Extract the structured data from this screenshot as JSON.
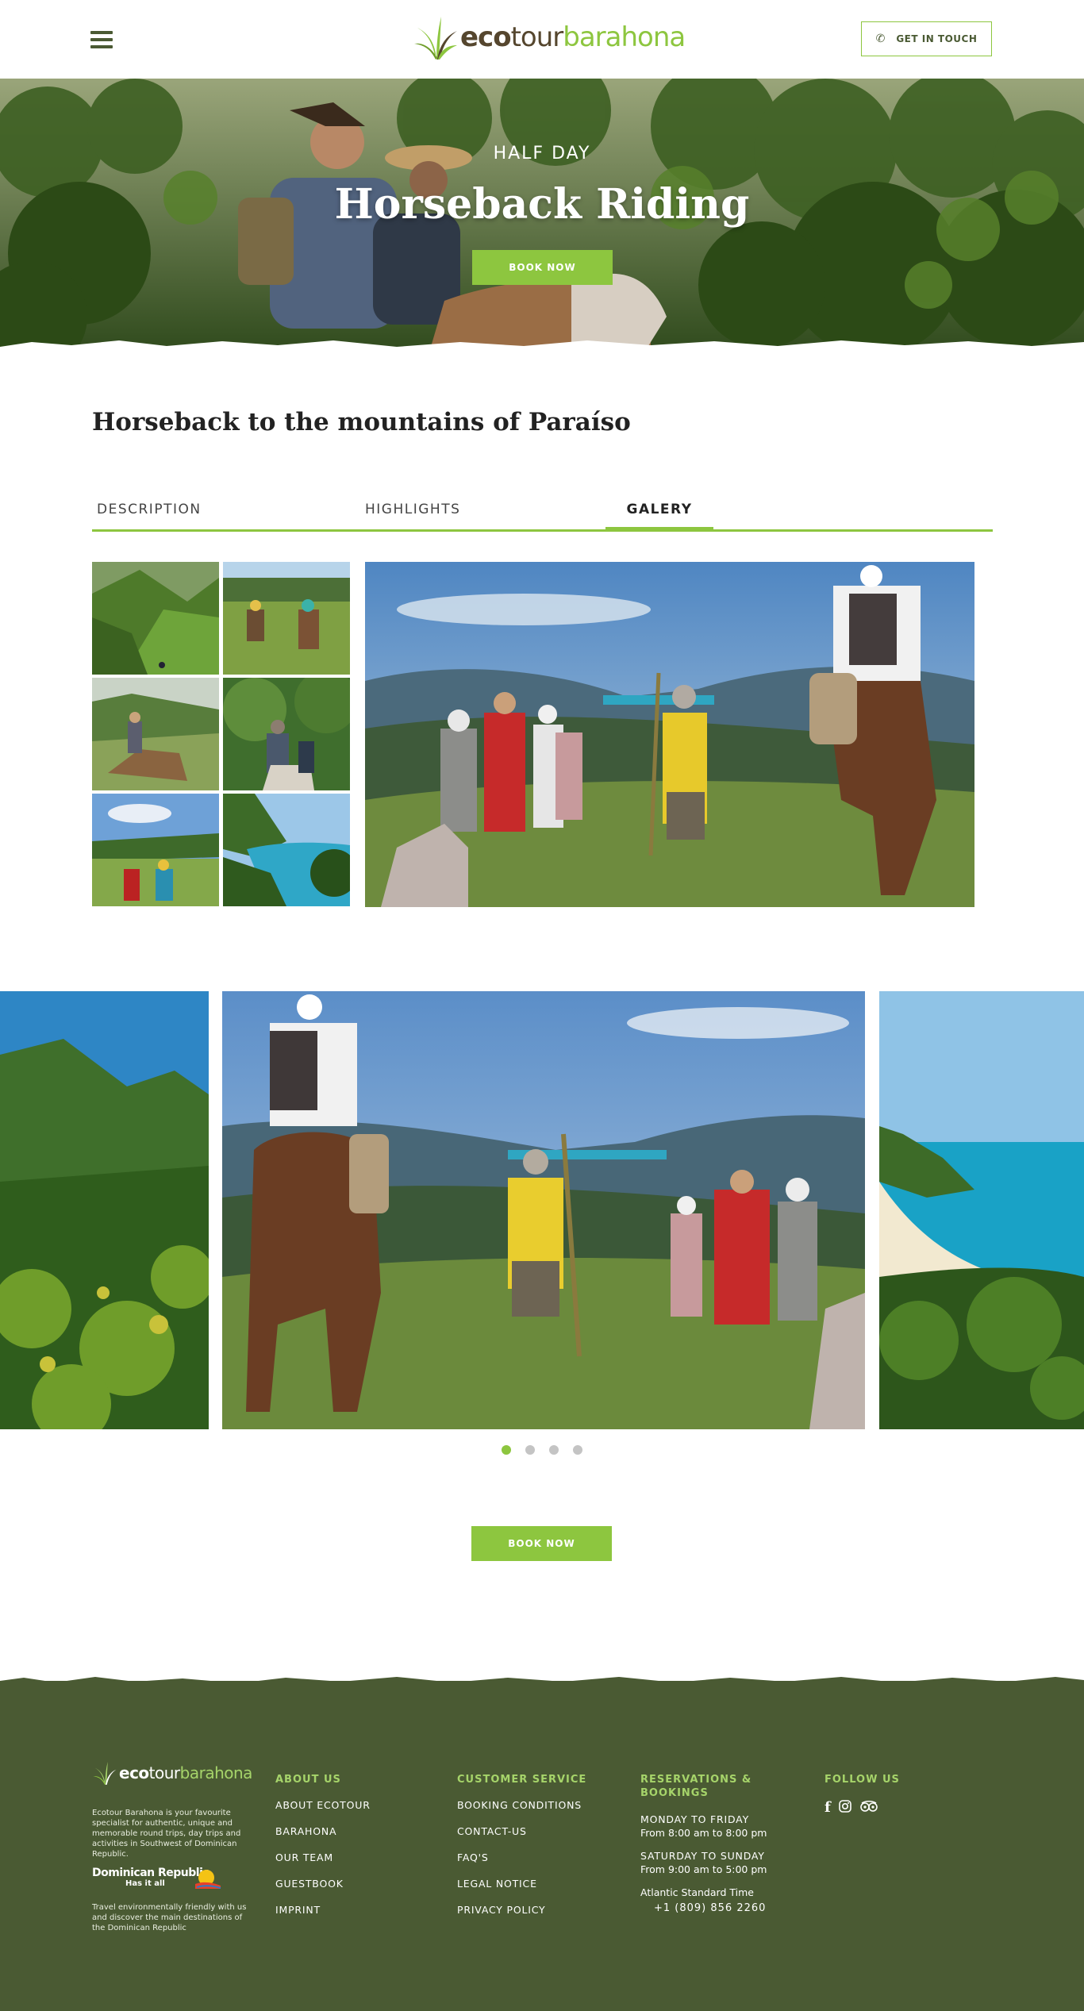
{
  "header": {
    "menu_icon": "hamburger-menu-icon",
    "logo": {
      "eco": "eco",
      "tour": "tour",
      "barahona": "barahona"
    },
    "cta_label": "GET IN TOUCH",
    "cta_icon": "phone-icon"
  },
  "hero": {
    "subtitle": "HALF DAY",
    "title": "Horseback Riding",
    "book_label": "BOOK NOW"
  },
  "main": {
    "heading": "Horseback to the mountains of Paraíso",
    "tabs": [
      {
        "label": "DESCRIPTION",
        "active": false
      },
      {
        "label": "HIGHLIGHTS",
        "active": false
      },
      {
        "label": "GALERY",
        "active": true
      }
    ],
    "gallery_thumbnails": 6,
    "carousel": {
      "slides": 4,
      "active_slide": 1
    },
    "book_label": "BOOK NOW"
  },
  "footer": {
    "logo": {
      "eco": "eco",
      "tour": "tour",
      "barahona": "barahona"
    },
    "about_text": "Ecotour Barahona is your favourite specialist for authentic, unique and memorable round trips, day trips and activities in Southwest of Dominican Republic.",
    "dr_logo": {
      "line1": "Dominican Republic",
      "line2": "Has it all"
    },
    "travel_text": "Travel environmentally friendly with us and discover the main destinations of the Dominican Republic",
    "about_us": {
      "heading": "ABOUT US",
      "links": [
        "ABOUT ECOTOUR",
        "BARAHONA",
        "OUR TEAM",
        "GUESTBOOK",
        "IMPRINT"
      ]
    },
    "customer_service": {
      "heading": "CUSTOMER SERVICE",
      "links": [
        "BOOKING CONDITIONS",
        "CONTACT-US",
        "FAQ'S",
        "LEGAL NOTICE",
        "PRIVACY POLICY"
      ]
    },
    "reservations": {
      "heading": "RESERVATIONS & BOOKINGS",
      "weekday_days": "MONDAY TO FRIDAY",
      "weekday_hours": "From 8:00 am to 8:00 pm",
      "weekend_days": "SATURDAY TO SUNDAY",
      "weekend_hours": "From 9:00 am to 5:00 pm",
      "timezone": "Atlantic Standard Time",
      "phone": "+1 (809) 856 2260"
    },
    "follow_us": {
      "heading": "FOLLOW US",
      "icons": [
        "facebook-icon",
        "instagram-icon",
        "tripadvisor-icon"
      ]
    }
  },
  "colors": {
    "accent": "#8dc63f",
    "footer_bg": "#4a5a33",
    "logo_brown": "#55462e"
  }
}
